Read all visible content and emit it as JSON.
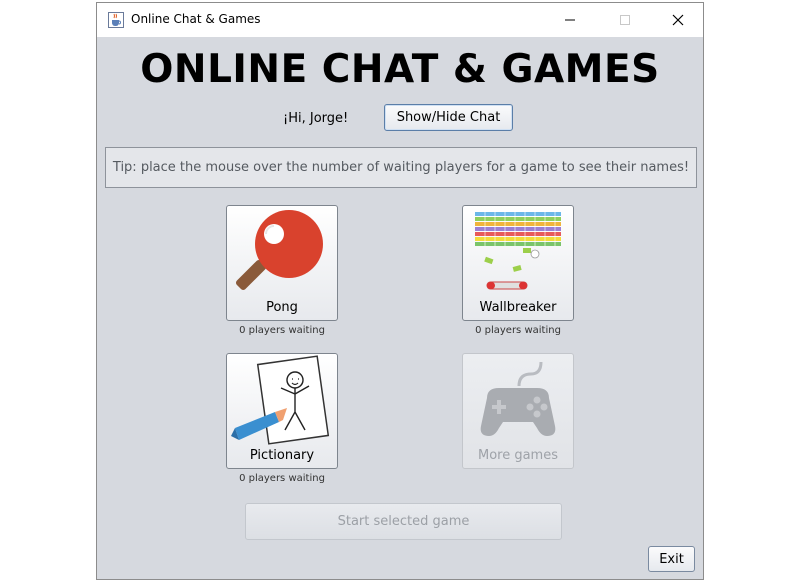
{
  "window": {
    "title": "Online Chat & Games",
    "app_icon": "java-cup-icon",
    "controls": [
      "minimize-icon",
      "maximize-icon",
      "close-icon"
    ]
  },
  "header": {
    "title": "ONLINE CHAT & GAMES",
    "greeting": "¡Hi, Jorge!",
    "chat_button_label": "Show/Hide Chat"
  },
  "tip": {
    "text": "Tip: place the mouse over the number of waiting players for a game to see their names!"
  },
  "games": [
    {
      "name": "Pong",
      "waiting": "0 players waiting",
      "icon": "ping-pong-paddle-icon",
      "enabled": true
    },
    {
      "name": "Wallbreaker",
      "waiting": "0 players waiting",
      "icon": "brick-breaker-icon",
      "enabled": true
    },
    {
      "name": "Pictionary",
      "waiting": "0 players waiting",
      "icon": "drawing-sketch-icon",
      "enabled": true
    },
    {
      "name": "More games",
      "waiting": "",
      "icon": "gamepad-icon",
      "enabled": false
    }
  ],
  "actions": {
    "start_label": "Start selected game",
    "exit_label": "Exit"
  },
  "colors": {
    "window_bg": "#d6d9df",
    "paddle_red": "#d9422d",
    "handle_brown": "#8a5a3a",
    "disabled_text": "#9ea2a8"
  }
}
